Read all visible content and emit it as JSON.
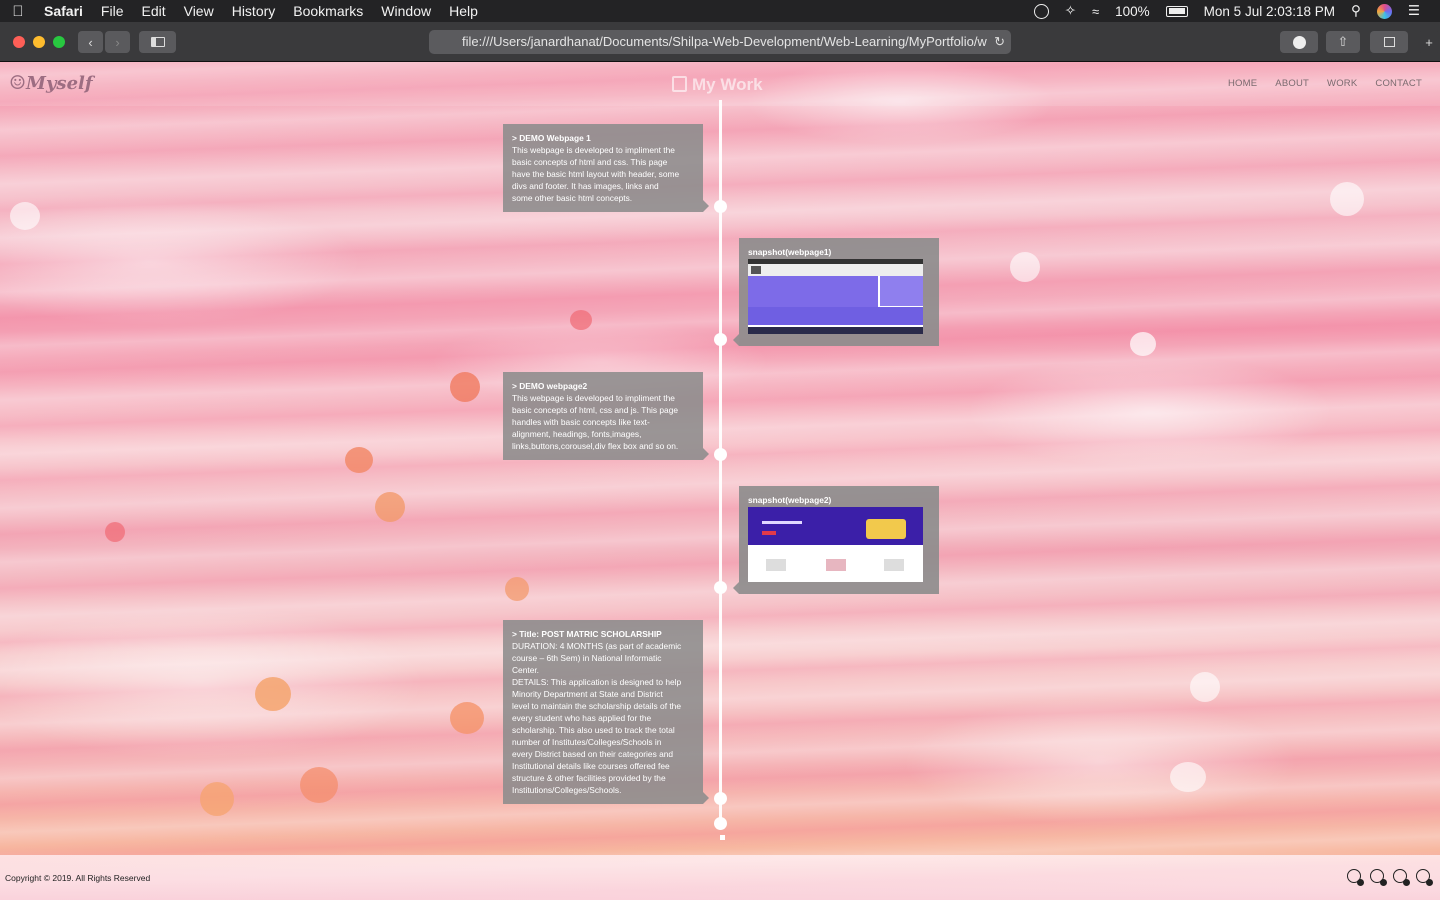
{
  "menubar": {
    "app": "Safari",
    "items": [
      "File",
      "Edit",
      "View",
      "History",
      "Bookmarks",
      "Window",
      "Help"
    ],
    "battery": "100%",
    "clock": "Mon 5 Jul  2:03:18 PM"
  },
  "browser": {
    "url": "file:///Users/janardhanat/Documents/Shilpa-Web-Development/Web-Learning/MyPortfolio/w"
  },
  "site": {
    "logo": "Myself",
    "logo_face": "☺",
    "title": "My Work",
    "nav": [
      "HOME",
      "ABOUT",
      "WORK",
      "CONTACT"
    ]
  },
  "timeline": [
    {
      "title": "> DEMO Webpage 1",
      "lines": [
        "This webpage is developed to impliment the",
        "basic concepts of html and css. This page",
        "have the basic html layout with header, some",
        "divs and footer. It has images, links and",
        "some other basic html concepts."
      ]
    },
    {
      "snapshot": "snapshot(webpage1)"
    },
    {
      "title": "> DEMO webpage2",
      "lines": [
        "This webpage is developed to impliment the",
        "basic concepts of html, css and js. This page",
        "handles with basic concepts like text-",
        "alignment, headings, fonts,images,",
        "links,buttons,corousel,div flex box and so on."
      ]
    },
    {
      "snapshot": "snapshot(webpage2)"
    },
    {
      "title": "> Title: POST MATRIC SCHOLARSHIP",
      "lines": [
        "DURATION: 4 MONTHS (as part of academic",
        "course – 6th Sem) in National Informatic",
        "Center.",
        "DETAILS: This application is designed to help",
        "Minority Department at State and District",
        "level to maintain the scholarship details of the",
        "every student who has applied for the",
        "scholarship. This also used to track the total",
        "number of Institutes/Colleges/Schools in",
        "every District based on their categories and",
        "Institutional details like courses offered fee",
        "structure & other facilities provided by the",
        "Institutions/Colleges/Schools."
      ]
    }
  ],
  "footer": {
    "copyright": "Copyright © 2019. All Rights Reserved"
  },
  "colors": {
    "card_bg": "#8c8c8c",
    "thumb1_accent": "#7d6be8",
    "thumb2_accent": "#3b1fa8"
  }
}
